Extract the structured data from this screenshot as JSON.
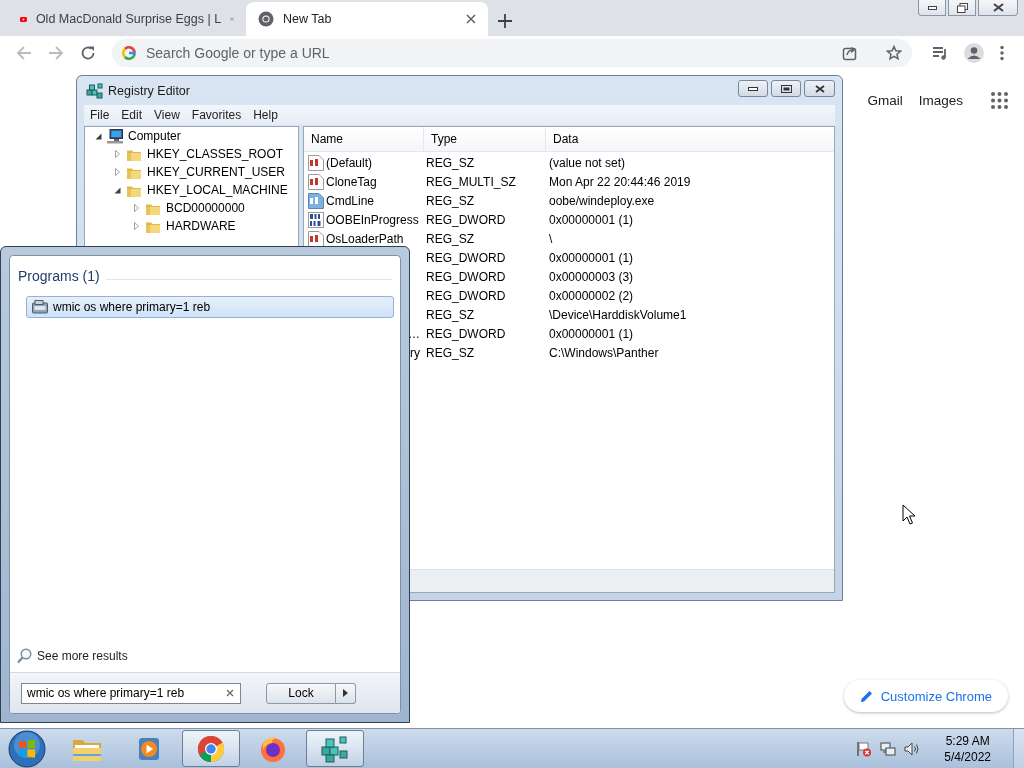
{
  "browser": {
    "tabs": [
      {
        "title": "Old MacDonald Surprise Eggs | L",
        "kind": "video",
        "selected": false
      },
      {
        "title": "New Tab",
        "kind": "chrome",
        "selected": true
      }
    ],
    "omnibox": {
      "placeholder": "Search Google or type a URL"
    }
  },
  "new_tab_page": {
    "links": [
      "Gmail",
      "Images"
    ],
    "customize_button": "Customize Chrome"
  },
  "registry_editor": {
    "title": "Registry Editor",
    "menu": [
      "File",
      "Edit",
      "View",
      "Favorites",
      "Help"
    ],
    "tree": [
      {
        "label": "Computer",
        "kind": "computer",
        "expanded": true,
        "children": [
          {
            "label": "HKEY_CLASSES_ROOT",
            "kind": "folder",
            "expanded": false
          },
          {
            "label": "HKEY_CURRENT_USER",
            "kind": "folder",
            "expanded": false
          },
          {
            "label": "HKEY_LOCAL_MACHINE",
            "kind": "folder",
            "expanded": true,
            "children": [
              {
                "label": "BCD00000000",
                "kind": "folder",
                "expanded": false
              },
              {
                "label": "HARDWARE",
                "kind": "folder",
                "expanded": false
              }
            ]
          }
        ]
      }
    ],
    "columns": [
      "Name",
      "Type",
      "Data"
    ],
    "values": [
      {
        "name": "(Default)",
        "kind": "string",
        "type": "REG_SZ",
        "data": "(value not set)"
      },
      {
        "name": "CloneTag",
        "kind": "string",
        "type": "REG_MULTI_SZ",
        "data": "Mon Apr 22 20:44:46 2019"
      },
      {
        "name": "CmdLine",
        "kind": "string_marked",
        "type": "REG_SZ",
        "data": "oobe/windeploy.exe"
      },
      {
        "name": "OOBEInProgress",
        "kind": "dword",
        "type": "REG_DWORD",
        "data": "0x00000001 (1)"
      },
      {
        "name": "OsLoaderPath",
        "kind": "string",
        "type": "REG_SZ",
        "data": "\\"
      },
      {
        "type": "REG_DWORD",
        "data": "0x00000001 (1)"
      },
      {
        "type": "REG_DWORD",
        "data": "0x00000003 (3)"
      },
      {
        "type": "REG_DWORD",
        "data": "0x00000002 (2)"
      },
      {
        "type": "REG_SZ",
        "data": "\\Device\\HarddiskVolume1"
      },
      {
        "name": "…",
        "name_clipped": true,
        "type": "REG_DWORD",
        "data": "0x00000001 (1)"
      },
      {
        "name": "ry",
        "name_clipped": true,
        "type": "REG_SZ",
        "data": "C:\\Windows\\Panther"
      }
    ]
  },
  "start_menu": {
    "section": "Programs (1)",
    "results": [
      {
        "label": "wmic os where primary=1 reb",
        "selected": true
      }
    ],
    "more": "See more results",
    "search": {
      "value": "wmic os where primary=1 reb"
    },
    "power_button": "Lock"
  },
  "taskbar": {
    "apps": [
      {
        "kind": "explorer",
        "active": false
      },
      {
        "kind": "media",
        "active": false
      },
      {
        "kind": "chrome",
        "active": true
      },
      {
        "kind": "firefox",
        "active": false
      },
      {
        "kind": "regedit",
        "active": true
      }
    ],
    "clock": {
      "time": "5:29 AM",
      "date": "5/4/2022"
    }
  }
}
